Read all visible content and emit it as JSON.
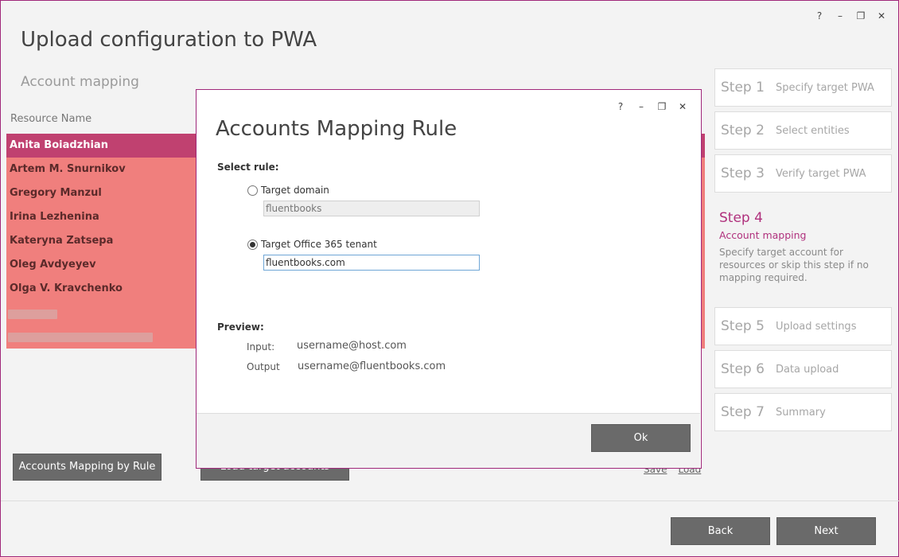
{
  "window": {
    "controls": {
      "help": "?",
      "minimize": "–",
      "restore": "❐",
      "close": "✕"
    },
    "title": "Upload configuration to PWA",
    "subtitle": "Account mapping"
  },
  "resources": {
    "column_header": "Resource Name",
    "rows": [
      "Anita Boiadzhian",
      "Artem M. Snurnikov",
      "Gregory Manzul",
      "Irina Lezhenina",
      "Kateryna Zatsepa",
      "Oleg Avdyeyev",
      "Olga V. Kravchenko"
    ],
    "selected_index": 0
  },
  "buttons": {
    "mapping_by_rule": "Accounts Mapping by Rule",
    "load_target": "Load target accounts",
    "back": "Back",
    "next": "Next"
  },
  "links": {
    "save": "Save",
    "load": "Load"
  },
  "steps": [
    {
      "num": "Step 1",
      "label": "Specify target PWA"
    },
    {
      "num": "Step 2",
      "label": "Select entities"
    },
    {
      "num": "Step 3",
      "label": "Verify target PWA"
    },
    {
      "num": "Step 4",
      "label": "Account mapping",
      "description": "Specify target account for resources or skip this step if no mapping required.",
      "active": true
    },
    {
      "num": "Step 5",
      "label": "Upload settings"
    },
    {
      "num": "Step 6",
      "label": "Data upload"
    },
    {
      "num": "Step 7",
      "label": "Summary"
    }
  ],
  "dialog": {
    "controls": {
      "help": "?",
      "minimize": "–",
      "restore": "❐",
      "close": "✕"
    },
    "title": "Accounts Mapping Rule",
    "select_rule_label": "Select rule:",
    "options": [
      {
        "label": "Target domain",
        "value": "fluentbooks",
        "checked": false
      },
      {
        "label": "Target Office 365 tenant",
        "value": "fluentbooks.com",
        "checked": true
      }
    ],
    "preview_label": "Preview:",
    "preview": {
      "input_label": "Input:",
      "input_value": "username@host.com",
      "output_label": "Output",
      "output_value": "username@fluentbooks.com"
    },
    "ok_label": "Ok"
  },
  "colors": {
    "accent": "#a0287a",
    "list_bg": "#f07f7d",
    "list_selected": "#c04170",
    "button_gray": "#6a6a6a"
  }
}
